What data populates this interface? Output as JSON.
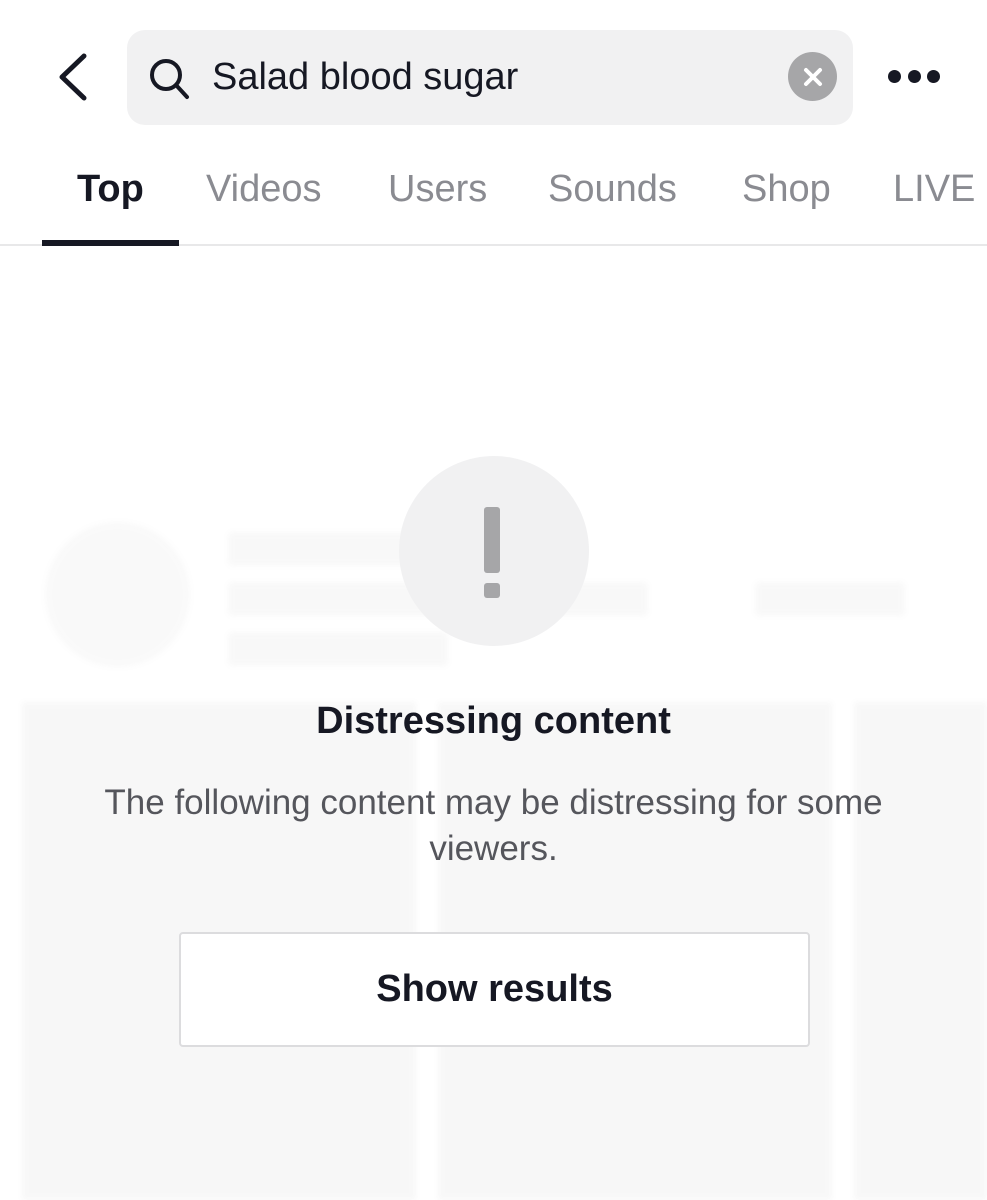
{
  "search": {
    "query": "Salad blood sugar",
    "icon": "search-icon",
    "clear_icon": "close-icon"
  },
  "header": {
    "back_icon": "chevron-left-icon",
    "more_icon": "more-horizontal-icon"
  },
  "tabs": [
    {
      "label": "Top",
      "active": true
    },
    {
      "label": "Videos",
      "active": false
    },
    {
      "label": "Users",
      "active": false
    },
    {
      "label": "Sounds",
      "active": false
    },
    {
      "label": "Shop",
      "active": false
    },
    {
      "label": "LIVE",
      "active": false
    }
  ],
  "warning": {
    "icon": "exclamation-icon",
    "title": "Distressing content",
    "description": "The following content may be distressing for some viewers.",
    "button_label": "Show results"
  },
  "colors": {
    "text_primary": "#161823",
    "text_secondary": "#8a8b91",
    "search_bg": "#f1f1f2",
    "icon_gray": "#a6a6a8"
  }
}
